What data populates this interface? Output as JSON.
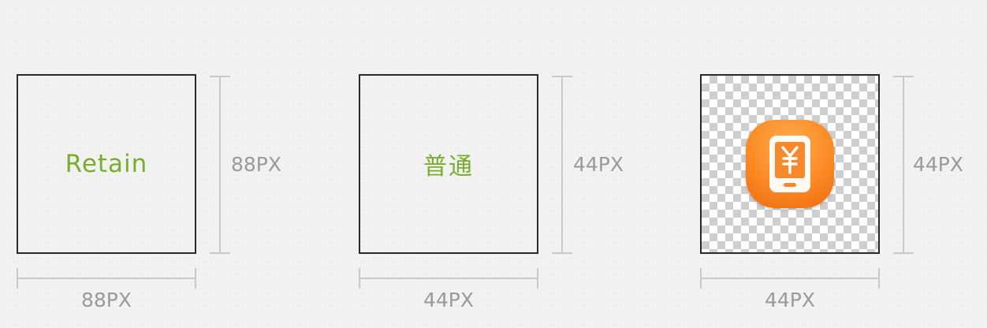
{
  "panels": [
    {
      "box_label": "Retain",
      "side_dimension": "88PX",
      "bottom_dimension": "88PX"
    },
    {
      "box_label": "普通",
      "side_dimension": "44PX",
      "bottom_dimension": "44PX"
    },
    {
      "icon": "phone-yuan-icon",
      "side_dimension": "44PX",
      "bottom_dimension": "44PX"
    }
  ],
  "colors": {
    "label_green": "#79ad2c",
    "icon_orange": "#fb8a24",
    "box_border": "#2a2a2a",
    "measure_gray": "#c9c9c9",
    "dimension_text": "#9a9a9a"
  }
}
